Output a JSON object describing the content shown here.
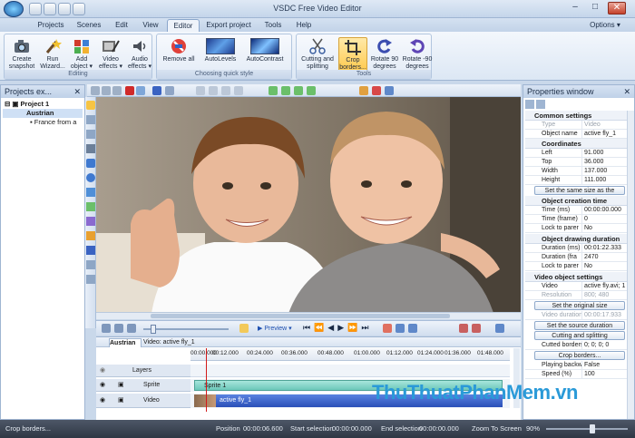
{
  "window": {
    "title": "VSDC Free Video Editor",
    "minimize": "–",
    "maximize": "□",
    "close": "✕"
  },
  "menu": {
    "tabs": [
      "Projects",
      "Scenes",
      "Edit",
      "View",
      "Editor",
      "Export project",
      "Tools",
      "Help"
    ],
    "active": "Editor",
    "options": "Options ▾"
  },
  "ribbon": {
    "editing": {
      "label": "Editing",
      "buttons": [
        {
          "label": "Create snapshot",
          "icon": "camera-icon"
        },
        {
          "label": "Run Wizard...",
          "icon": "wizard-wand-icon"
        },
        {
          "label": "Add object ▾",
          "icon": "add-object-icon"
        },
        {
          "label": "Video effects ▾",
          "icon": "video-effects-icon"
        },
        {
          "label": "Audio effects ▾",
          "icon": "audio-effects-icon"
        }
      ]
    },
    "quick_style": {
      "label": "Choosing quick style",
      "buttons": [
        {
          "label": "Remove all",
          "icon": "remove-all-icon"
        },
        {
          "label": "AutoLevels",
          "icon": "autolevels-icon"
        },
        {
          "label": "AutoContrast",
          "icon": "autocontrast-icon"
        }
      ]
    },
    "tools": {
      "label": "Tools",
      "buttons": [
        {
          "label": "Cutting and splitting",
          "icon": "scissors-icon"
        },
        {
          "label": "Crop borders...",
          "icon": "crop-icon"
        },
        {
          "label": "Rotate 90 degrees",
          "icon": "rotate-right-icon"
        },
        {
          "label": "Rotate -90 degrees",
          "icon": "rotate-left-icon"
        }
      ]
    }
  },
  "projects_panel": {
    "title": "Projects ex...",
    "pin": "✕",
    "tree": [
      {
        "label": "Project 1",
        "level": 0
      },
      {
        "label": "Austrian",
        "level": 1
      },
      {
        "label": "France from a",
        "level": 2
      }
    ]
  },
  "properties_panel": {
    "title": "Properties window",
    "pin": "✕",
    "sections": {
      "common": {
        "title": "Common settings",
        "rows": [
          {
            "k": "Type",
            "v": "Video",
            "grey": true
          },
          {
            "k": "Object name",
            "v": "active fly_1"
          }
        ]
      },
      "coordinates": {
        "title": "Coordinates",
        "rows": [
          {
            "k": "Left",
            "v": "91.000"
          },
          {
            "k": "Top",
            "v": "36.000"
          },
          {
            "k": "Width",
            "v": "137.000"
          },
          {
            "k": "Height",
            "v": "111.000"
          }
        ],
        "button": "Set the same size as the parent"
      },
      "creation": {
        "title": "Object creation time",
        "rows": [
          {
            "k": "Time (ms)",
            "v": "00:00:00.000"
          },
          {
            "k": "Time (frame)",
            "v": "0"
          },
          {
            "k": "Lock to parer",
            "v": "No"
          }
        ]
      },
      "duration": {
        "title": "Object drawing duration",
        "rows": [
          {
            "k": "Duration (ms)",
            "v": "00:01:22.333"
          },
          {
            "k": "Duration (fra",
            "v": "2470"
          },
          {
            "k": "Lock to parer",
            "v": "No"
          }
        ]
      },
      "video": {
        "title": "Video object settings",
        "rows": [
          {
            "k": "Video",
            "v": "active fly.avi; 1"
          },
          {
            "k": "Resolution",
            "v": "800; 480",
            "grey": true
          }
        ],
        "button1": "Set the original size",
        "row2": {
          "k": "Video duration",
          "v": "00:00:17.933",
          "grey": true
        },
        "button2": "Set the source duration",
        "button3": "Cutting and splitting",
        "row3": {
          "k": "Cutted borders",
          "v": "0; 0; 0; 0"
        },
        "button4": "Crop borders...",
        "row4": {
          "k": "Playing backwar",
          "v": "False"
        },
        "row5": {
          "k": "Speed (%)",
          "v": "100"
        }
      }
    }
  },
  "playbar": {
    "preview": "▶ Preview ▾"
  },
  "timeline": {
    "tabs": [
      "Austrian",
      "Video: active fly_1"
    ],
    "ruler": [
      "00:00.000",
      "00:12.000",
      "00:24.000",
      "00:36.000",
      "00:48.000",
      "01:00.000",
      "01:12.000",
      "01:24.000",
      "01:36.000",
      "01:48.000"
    ],
    "tracks": [
      {
        "name": "Layers"
      },
      {
        "name": "Sprite",
        "clip": "Sprite 1"
      },
      {
        "name": "Video",
        "clip": "active fly_1"
      }
    ]
  },
  "status": {
    "left": "Crop borders...",
    "position_label": "Position",
    "position": "00:00:06.600",
    "start_label": "Start selection",
    "start": "00:00:00.000",
    "end_label": "End selection",
    "end": "00:00:00.000",
    "zoom": "Zoom To Screen",
    "zoom_pct": "90%"
  },
  "watermark": "ThuThuatPhanMem.vn",
  "colors": {
    "accent": "#2a9ad8",
    "ribbon_bg": "#dce7f4",
    "clip_sprite": "#7fd4c8",
    "clip_video": "#2d57c8",
    "playhead": "#d21a1a"
  }
}
